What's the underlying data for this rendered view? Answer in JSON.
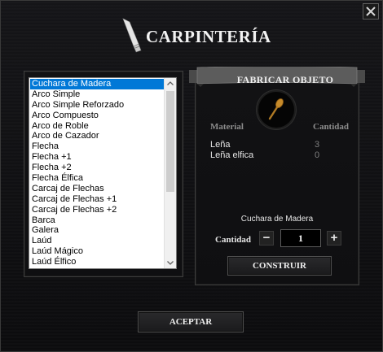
{
  "window": {
    "title": "CARPINTERÍA",
    "close_label": "X"
  },
  "icons": {
    "title_icon": "saw-icon",
    "item_icon": "wooden-spoon-icon"
  },
  "recipes": {
    "selected_index": 0,
    "items": [
      "Cuchara de Madera",
      "Arco Simple",
      "Arco Simple Reforzado",
      "Arco Compuesto",
      "Arco de Roble",
      "Arco de Cazador",
      "Flecha",
      "Flecha +1",
      "Flecha +2",
      "Flecha Élfica",
      "Carcaj de Flechas",
      "Carcaj de Flechas +1",
      "Carcaj de Flechas +2",
      "Barca",
      "Galera",
      "Laúd",
      "Laúd Mágico",
      "Laúd Élfico"
    ]
  },
  "craft": {
    "banner": "FABRICAR OBJETO",
    "header_material": "Material",
    "header_quantity": "Cantidad",
    "materials": [
      {
        "name": "Leña",
        "qty": "3"
      },
      {
        "name": "Leña elfica",
        "qty": "0"
      }
    ],
    "selected_name": "Cuchara de Madera",
    "quantity_label": "Cantidad",
    "quantity_value": "1",
    "minus": "−",
    "plus": "+",
    "build_label": "CONSTRUIR"
  },
  "footer": {
    "accept_label": "ACEPTAR"
  },
  "colors": {
    "selection": "#0078d7",
    "text": "#e6e6e6",
    "muted": "#8d8d8d"
  }
}
